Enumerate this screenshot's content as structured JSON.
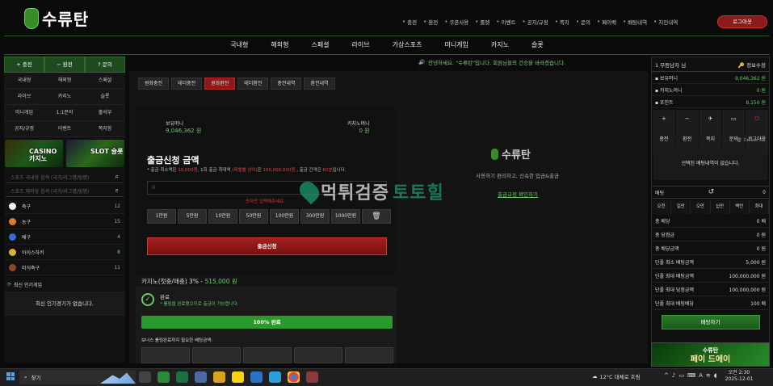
{
  "header": {
    "logo_text": "수류탄",
    "nav": [
      {
        "icon": "plus-icon",
        "label": "충전"
      },
      {
        "icon": "minus-icon",
        "label": "환전"
      },
      {
        "icon": "ticket-icon",
        "label": "쿠폰사용"
      },
      {
        "icon": "roulette-icon",
        "label": "룰렛"
      },
      {
        "icon": "gift-icon",
        "label": "이벤트"
      },
      {
        "icon": "info-icon",
        "label": "공지/규정"
      },
      {
        "icon": "note-icon",
        "label": "쪽지"
      },
      {
        "icon": "question-icon",
        "label": "문의"
      },
      {
        "icon": "coin-icon",
        "label": "페이백"
      },
      {
        "icon": "list-icon",
        "label": "배팅내역"
      },
      {
        "icon": "people-icon",
        "label": "지인내역"
      }
    ],
    "login_button": "로그아웃"
  },
  "main_nav": [
    "국내형",
    "해외형",
    "스페셜",
    "라이브",
    "가상스포츠",
    "미니게임",
    "카지노",
    "슬롯"
  ],
  "left_sidebar": {
    "quick": [
      {
        "icon": "+",
        "label": "충전"
      },
      {
        "icon": "−",
        "label": "환전"
      },
      {
        "icon": "?",
        "label": "문의"
      }
    ],
    "menu": [
      "국내형",
      "해외형",
      "스페셜",
      "라이브",
      "카지노",
      "슬롯",
      "미니게임",
      "1:1문의",
      "출석부",
      "공지/규정",
      "이벤트",
      "쪽지함"
    ],
    "banners": [
      {
        "label": "CASINO 카지노"
      },
      {
        "label": "SLOT 슬롯"
      }
    ],
    "search": [
      {
        "placeholder": "스포츠 국내형 검색 (국가/리그명/팀명)"
      },
      {
        "placeholder": "스포츠 해외형 검색 (국가/리그명/팀명)"
      }
    ],
    "sports": [
      {
        "name": "축구",
        "count": "12",
        "color": "#f0f0f0"
      },
      {
        "name": "농구",
        "count": "15",
        "color": "#e07a2a"
      },
      {
        "name": "배구",
        "count": "4",
        "color": "#3a6ad8"
      },
      {
        "name": "아이스하키",
        "count": "8",
        "color": "#d8b23a"
      },
      {
        "name": "미식축구",
        "count": "11",
        "color": "#8a4a2a"
      }
    ],
    "popular_title": "최신 인기게임",
    "popular_empty": "최신 인기경기가 없습니다."
  },
  "notice": "안녕하세요. \"수류탄\"입니다. 회원님들의 건승을 바라겠습니다.",
  "tabs": [
    {
      "label": "원화충전",
      "active": false
    },
    {
      "label": "테더충전",
      "active": false
    },
    {
      "label": "원화환전",
      "active": true
    },
    {
      "label": "테더환전",
      "active": false
    },
    {
      "label": "충전내역",
      "active": false
    },
    {
      "label": "환전내역",
      "active": false
    }
  ],
  "withdraw": {
    "money_label": "보유머니",
    "money_value": "9,046,362 원",
    "casino_label": "카지노머니",
    "casino_value": "0 원",
    "title": "출금신청 금액",
    "desc_a": "* 출금 최소액은 ",
    "desc_min": "10,000원",
    "desc_b": ", 1회 출금 최대액 ",
    "desc_note": "(레벨별 상이)",
    "desc_c": "은 ",
    "desc_max": "100,000,000원",
    "desc_d": " , 출금 간격은 ",
    "desc_gap": "60분",
    "desc_e": "입니다.",
    "amount_value": "0",
    "error": "숫자만 입력해주세요.",
    "amounts": [
      "1만원",
      "5만원",
      "10만원",
      "50만원",
      "100만원",
      "300만원",
      "1000만원"
    ],
    "submit": "출금신청"
  },
  "right_info": {
    "logo_text": "수류탄",
    "text": "사용하기 편리하고, 신속한 입금&출금",
    "link": "출금규정 확인하기"
  },
  "watermark": {
    "a": "먹튀검증",
    "b": "토토힐"
  },
  "casino_rolling": {
    "title": "카지노(첫충/매충) 3%",
    "sep": "  -  ",
    "value": "515,000 원",
    "done_label": "완료",
    "done_desc": "* 롤링을 완료했으므로 출금이 가능합니다.",
    "progress": 100,
    "progress_label": "100% 완료",
    "bonus_text": "보너스 롤링완료까지 필요한 배팅금액:"
  },
  "right_sidebar": {
    "user": "1  무등남자 님",
    "edit": "정보수정",
    "rows": [
      {
        "icon": "wallet-icon",
        "label": "보유머니",
        "value": "9,046,362 원"
      },
      {
        "icon": "casino-icon",
        "label": "카지노머니",
        "value": "0 원"
      },
      {
        "icon": "point-icon",
        "label": "포인트",
        "value": "8,150 원"
      }
    ],
    "actions": [
      {
        "label": "충전",
        "icon": "+"
      },
      {
        "label": "환전",
        "icon": "−"
      },
      {
        "label": "쪽지",
        "icon": "✈"
      },
      {
        "label": "문의",
        "icon": "▭"
      },
      {
        "label": "로그아웃",
        "icon": "⏻"
      }
    ],
    "delete_all": "Delete All",
    "slip_empty": "선택된 배팅내역이 없습니다.",
    "bet_label": "배팅",
    "bet_value": "0",
    "chips": [
      "오천",
      "일만",
      "오만",
      "십만",
      "백만",
      "최대"
    ],
    "kv": [
      {
        "k": "총 배당",
        "v": "0 배"
      },
      {
        "k": "총 당첨금",
        "v": "0 원"
      },
      {
        "k": "총 배당금액",
        "v": "0 원"
      },
      {
        "k": "단폴 최소 배팅금액",
        "v": "5,000 원"
      },
      {
        "k": "단폴 최대 배팅금액",
        "v": "100,000,000 원"
      },
      {
        "k": "단폴 최대 당첨금액",
        "v": "100,000,000 원"
      },
      {
        "k": "단폴 최대 배팅배당",
        "v": "100 배"
      }
    ],
    "bet_button": "배팅하기",
    "banner_top": "수류탄",
    "banner_text": "페이 드에이"
  },
  "taskbar": {
    "search": "찾기",
    "weather": "12°C  대체로 흐림",
    "time": "오전 2:30",
    "date": "2025-12-01"
  }
}
